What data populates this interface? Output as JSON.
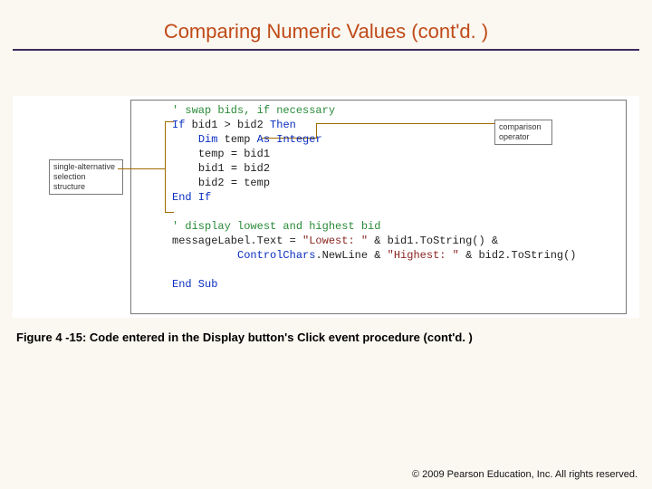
{
  "title": "Comparing Numeric Values (cont'd. )",
  "code": {
    "comment1": "' swap bids, if necessary",
    "if_kw": "If",
    "if_cond_l": "bid1",
    "if_cond_op": ">",
    "if_cond_r": "bid2",
    "then_kw": "Then",
    "dim_kw": "Dim",
    "dim_var": "temp",
    "as_kw": "As",
    "dim_type": "Integer",
    "a1_l": "temp",
    "a1_r": "bid1",
    "a2_l": "bid1",
    "a2_r": "bid2",
    "a3_l": "bid2",
    "a3_r": "temp",
    "endif_kw": "End If",
    "comment2": "' display lowest and highest bid",
    "msg_obj": "messageLabel.Text",
    "eq": "=",
    "str_low": "\"Lowest: \"",
    "amp": "&",
    "b1ts": "bid1.ToString()",
    "cc": "ControlChars",
    "nl": ".NewLine",
    "str_hi": "\"Highest: \"",
    "b2ts": "bid2.ToString()",
    "endsub_kw": "End Sub"
  },
  "callout_left": "single-alternative selection structure",
  "callout_right": "comparison operator",
  "caption": "Figure 4 -15: Code entered in the Display button's Click event procedure (cont'd. )",
  "footer_copyright": "2009 Pearson Education, Inc. All rights reserved."
}
